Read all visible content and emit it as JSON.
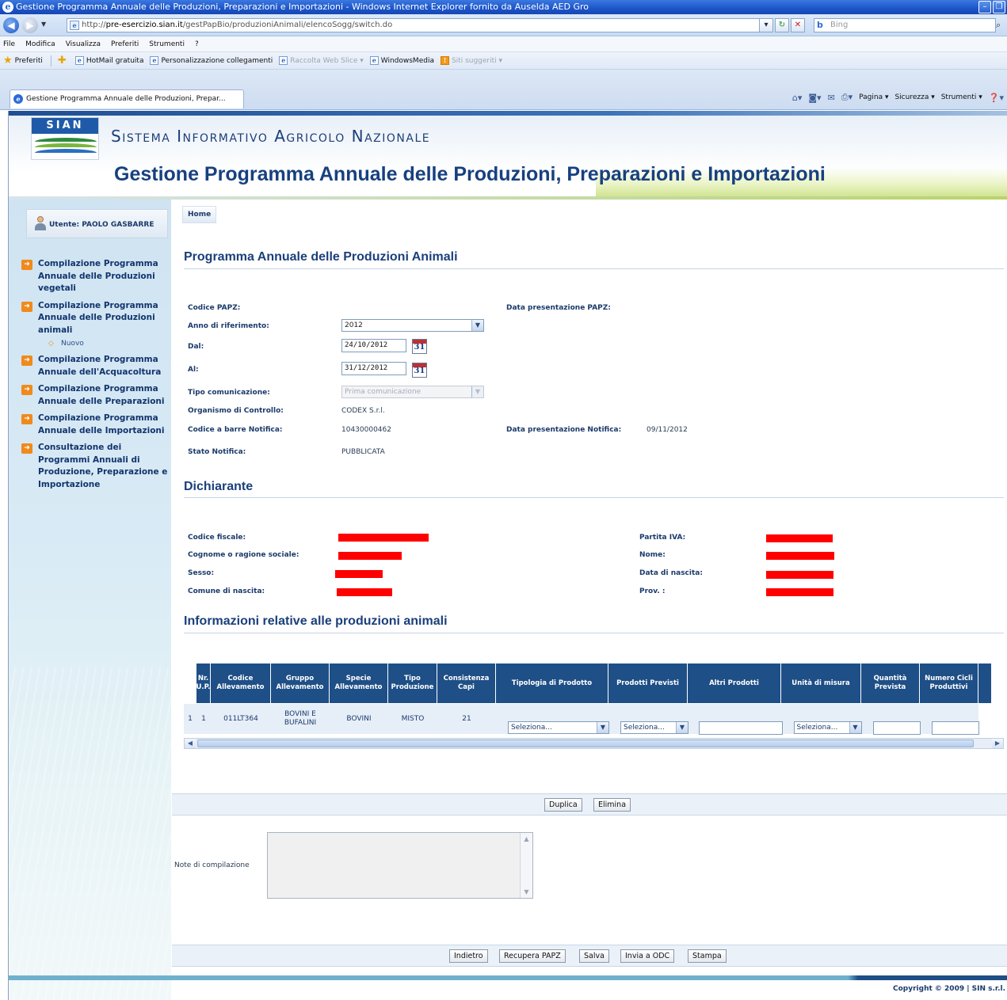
{
  "browser": {
    "window_title": "Gestione Programma Annuale delle Produzioni, Preparazioni e Importazioni - Windows Internet Explorer fornito da Auselda AED Gro",
    "url_prefix": "http://",
    "url_host": "pre-esercizio.sian.it",
    "url_path": "/gestPapBio/produzioniAnimali/elencoSogg/switch.do",
    "search_placeholder": "Bing",
    "menu": [
      "File",
      "Modifica",
      "Visualizza",
      "Preferiti",
      "Strumenti",
      "?"
    ],
    "favorites_label": "Preferiti",
    "favorites": [
      {
        "label": "HotMail gratuita",
        "muted": false
      },
      {
        "label": "Personalizzazione collegamenti",
        "muted": false
      },
      {
        "label": "Raccolta Web Slice ▾",
        "muted": true
      },
      {
        "label": "WindowsMedia",
        "muted": false
      },
      {
        "label": "Siti suggeriti ▾",
        "muted": true
      }
    ],
    "tab_title": "Gestione Programma Annuale delle Produzioni, Prepar...",
    "command_bar": [
      "Pagina ▾",
      "Sicurezza ▾",
      "Strumenti ▾"
    ]
  },
  "banner": {
    "logo_text": "SIAN",
    "system_name": "Sistema Informativo Agricolo Nazionale",
    "app_title": "Gestione Programma Annuale delle Produzioni, Preparazioni e Importazioni"
  },
  "sidebar": {
    "user_label": "Utente: PAOLO GASBARRE",
    "menu": [
      {
        "label": "Compilazione Programma Annuale delle Produzioni vegetali"
      },
      {
        "label": "Compilazione Programma Annuale delle Produzioni animali"
      },
      {
        "label": "Compilazione Programma Annuale dell'Acquacoltura"
      },
      {
        "label": "Compilazione Programma Annuale delle Preparazioni"
      },
      {
        "label": "Compilazione Programma Annuale delle Importazioni"
      },
      {
        "label": "Consultazione dei Programmi Annuali di Produzione, Preparazione e Importazione"
      }
    ],
    "submenu_label": "Nuovo"
  },
  "main": {
    "breadcrumb": "Home",
    "section1_title": "Programma Annuale delle Produzioni Animali",
    "fields": {
      "codice_papz": "Codice PAPZ:",
      "data_presentazione_papz": "Data presentazione PAPZ:",
      "anno_label": "Anno di riferimento:",
      "anno_value": "2012",
      "dal_label": "Dal:",
      "dal_value": "24/10/2012",
      "al_label": "Al:",
      "al_value": "31/12/2012",
      "calendar_day": "31",
      "tipo_label": "Tipo comunicazione:",
      "tipo_value": "Prima comunicazione",
      "organismo_label": "Organismo di Controllo:",
      "organismo_value": "CODEX S.r.l.",
      "barcode_label": "Codice a barre Notifica:",
      "barcode_value": "10430000462",
      "data_notifica_label": "Data presentazione Notifica:",
      "data_notifica_value": "09/11/2012",
      "stato_label": "Stato Notifica:",
      "stato_value": "PUBBLICATA"
    },
    "section2_title": "Dichiarante",
    "dichiarante": {
      "codice_fiscale": "Codice fiscale:",
      "cognome": "Cognome o ragione sociale:",
      "sesso": "Sesso:",
      "comune": "Comune di nascita:",
      "partita_iva": "Partita IVA:",
      "nome": "Nome:",
      "data_nascita": "Data di nascita:",
      "prov": "Prov. :"
    },
    "section3_title": "Informazioni relative alle produzioni animali",
    "grid": {
      "headers": [
        "",
        "Nr. U.P.",
        "Codice Allevamento",
        "Gruppo Allevamento",
        "Specie Allevamento",
        "Tipo Produzione",
        "Consistenza Capi",
        "Tipologia di Prodotto",
        "Prodotti Previsti",
        "Altri Prodotti",
        "Unità di misura",
        "Quantità Prevista",
        "Numero Cicli Produttivi"
      ],
      "row": {
        "idx": "1",
        "nr_up": "1",
        "codice": "011LT364",
        "gruppo": "BOVINI E BUFALINI",
        "specie": "BOVINI",
        "tipo": "MISTO",
        "consistenza": "21",
        "tipologia_select": "Seleziona...",
        "prodotti_select": "Seleziona...",
        "unita_select": "Seleziona..."
      }
    },
    "buttons": {
      "duplica": "Duplica",
      "elimina": "Elimina",
      "indietro": "Indietro",
      "recupera": "Recupera PAPZ",
      "salva": "Salva",
      "invia": "Invia a ODC",
      "stampa": "Stampa"
    },
    "note_label": "Note di compilazione"
  },
  "footer": {
    "copyright": "Copyright © 2009 | SIN s.r.l."
  }
}
